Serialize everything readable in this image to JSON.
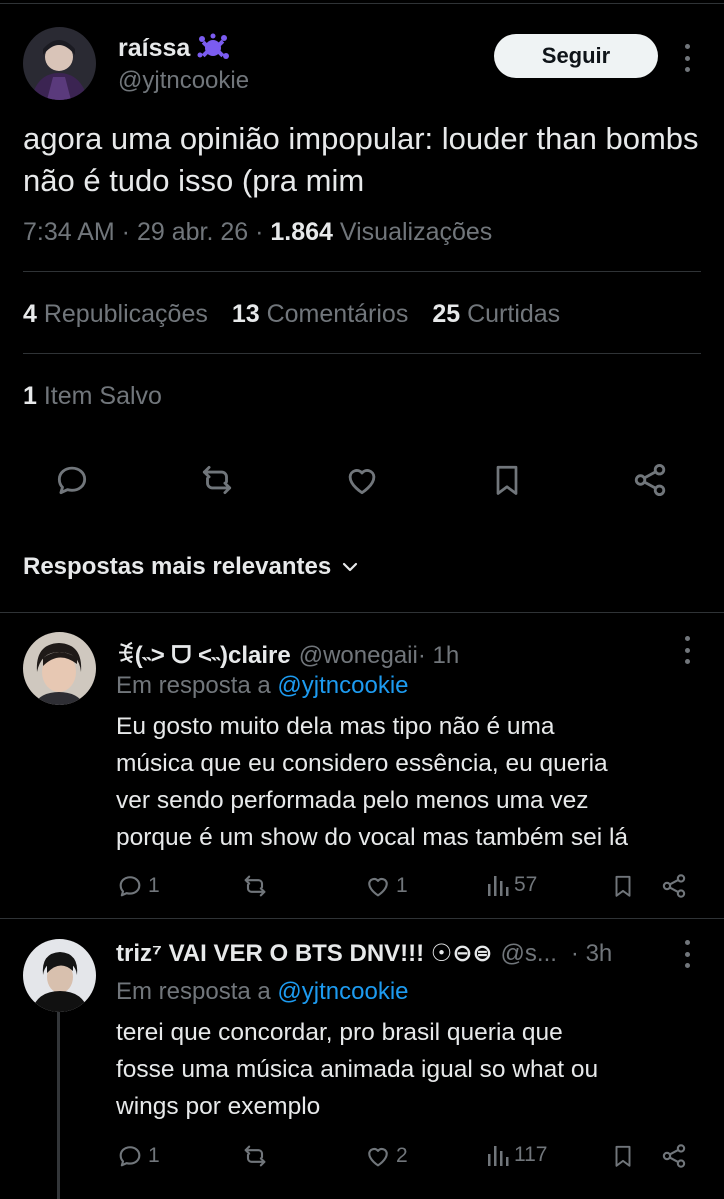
{
  "post": {
    "author_name": "raíssa",
    "author_handle": "@yjtncookie",
    "follow_label": "Seguir",
    "text": "agora uma opinião impopular: louder than bombs não é tudo isso (pra mim",
    "time": "7:34 AM · 29 abr. 26 · ",
    "views_count": "1.864",
    "views_label": " Visualizações",
    "stats": {
      "reposts_count": "4",
      "reposts_label": " Republicações",
      "comments_count": "13",
      "comments_label": " Comentários",
      "likes_count": "25",
      "likes_label": " Curtidas"
    },
    "saved_count": "1",
    "saved_label": " Item Salvo",
    "actions": [
      "reply-icon",
      "repost-icon",
      "like-icon",
      "bookmark-icon",
      "share-icon"
    ]
  },
  "sort": {
    "label": "Respostas mais relevantes"
  },
  "replies": [
    {
      "name": "ꉂ(˵˃ ᗜ ˂˵)claire",
      "handle": "@wonegaii",
      "time": " · 1h",
      "reply_prefix": "Em resposta a ",
      "mention": "@yjtncookie",
      "lines": [
        "Eu gosto muito dela mas tipo não é uma",
        "música que eu considero essência, eu queria",
        "ver sendo performada pelo menos uma vez",
        "porque é um show do vocal mas também sei lá"
      ],
      "replies": "1",
      "likes": "1",
      "views": "57"
    },
    {
      "name": "triz⁷ VAI VER O BTS DNV!!! ☉⊖⊜",
      "handle": "@s...",
      "time": " · 3h",
      "reply_prefix": "Em resposta a ",
      "mention": "@yjtncookie",
      "lines": [
        "terei que concordar, pro brasil queria que",
        "fosse uma música animada igual so what ou",
        "wings por exemplo"
      ],
      "replies": "1",
      "likes": "2",
      "views": "117"
    }
  ],
  "colors": {
    "background": "#000000",
    "text": "#e7e9ea",
    "muted": "#71767b",
    "link": "#1d9bf0",
    "divider": "#2f3336",
    "badge": "#7b5cf0"
  }
}
